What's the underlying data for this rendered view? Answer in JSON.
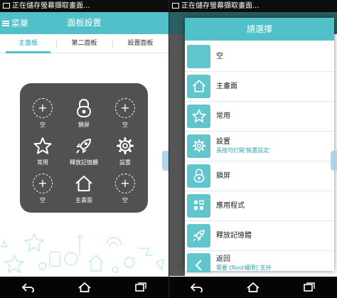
{
  "status_bar": {
    "notification_text": "正在儲存螢幕擷取畫面..."
  },
  "app_bar": {
    "menu_label": "菜單",
    "title": "面板設置"
  },
  "tabs": [
    {
      "label": "主面板",
      "active": true
    },
    {
      "label": "第二面板",
      "active": false
    },
    {
      "label": "設置面板",
      "active": false
    }
  ],
  "panel": {
    "cells": [
      {
        "label": "空",
        "icon": "plus-circle-icon"
      },
      {
        "label": "鎖屏",
        "icon": "lock-icon"
      },
      {
        "label": "空",
        "icon": "plus-circle-icon"
      },
      {
        "label": "常用",
        "icon": "star-icon"
      },
      {
        "label": "釋放記憶體",
        "icon": "rocket-icon"
      },
      {
        "label": "設置",
        "icon": "gear-icon"
      },
      {
        "label": "空",
        "icon": "plus-circle-icon"
      },
      {
        "label": "主畫面",
        "icon": "home-icon"
      },
      {
        "label": "空",
        "icon": "plus-circle-icon"
      }
    ]
  },
  "dialog": {
    "title": "請選擇",
    "items": [
      {
        "label": "空",
        "sub": "",
        "icon": "blank-icon"
      },
      {
        "label": "主畫面",
        "sub": "",
        "icon": "home-icon"
      },
      {
        "label": "常用",
        "sub": "",
        "icon": "star-icon"
      },
      {
        "label": "設置",
        "sub": "長按可打開'裝置設定'",
        "icon": "gear-icon"
      },
      {
        "label": "鎖屏",
        "sub": "",
        "icon": "lock-icon"
      },
      {
        "label": "應用程式",
        "sub": "",
        "icon": "apps-grid-icon"
      },
      {
        "label": "釋放記憶體",
        "sub": "",
        "icon": "rocket-icon"
      },
      {
        "label": "返回",
        "sub": "需要 [Root權限] 支持",
        "icon": "back-arrow-icon"
      }
    ]
  },
  "colors": {
    "accent": "#52c0c8",
    "panel_bg": "#515151",
    "sub_text": "#2aa7b2"
  }
}
